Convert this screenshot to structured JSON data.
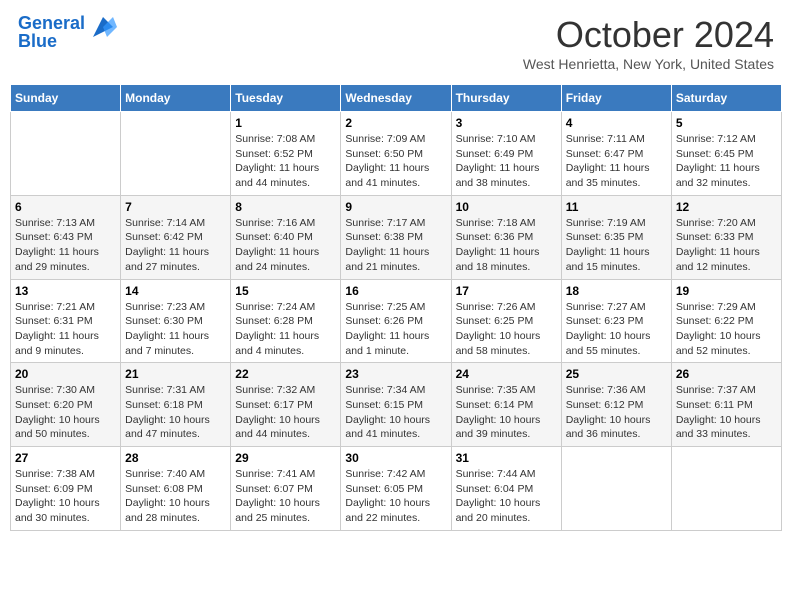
{
  "header": {
    "logo_line1": "General",
    "logo_line2": "Blue",
    "month_title": "October 2024",
    "location": "West Henrietta, New York, United States"
  },
  "days_of_week": [
    "Sunday",
    "Monday",
    "Tuesday",
    "Wednesday",
    "Thursday",
    "Friday",
    "Saturday"
  ],
  "weeks": [
    [
      {
        "day": "",
        "info": ""
      },
      {
        "day": "",
        "info": ""
      },
      {
        "day": "1",
        "info": "Sunrise: 7:08 AM\nSunset: 6:52 PM\nDaylight: 11 hours and 44 minutes."
      },
      {
        "day": "2",
        "info": "Sunrise: 7:09 AM\nSunset: 6:50 PM\nDaylight: 11 hours and 41 minutes."
      },
      {
        "day": "3",
        "info": "Sunrise: 7:10 AM\nSunset: 6:49 PM\nDaylight: 11 hours and 38 minutes."
      },
      {
        "day": "4",
        "info": "Sunrise: 7:11 AM\nSunset: 6:47 PM\nDaylight: 11 hours and 35 minutes."
      },
      {
        "day": "5",
        "info": "Sunrise: 7:12 AM\nSunset: 6:45 PM\nDaylight: 11 hours and 32 minutes."
      }
    ],
    [
      {
        "day": "6",
        "info": "Sunrise: 7:13 AM\nSunset: 6:43 PM\nDaylight: 11 hours and 29 minutes."
      },
      {
        "day": "7",
        "info": "Sunrise: 7:14 AM\nSunset: 6:42 PM\nDaylight: 11 hours and 27 minutes."
      },
      {
        "day": "8",
        "info": "Sunrise: 7:16 AM\nSunset: 6:40 PM\nDaylight: 11 hours and 24 minutes."
      },
      {
        "day": "9",
        "info": "Sunrise: 7:17 AM\nSunset: 6:38 PM\nDaylight: 11 hours and 21 minutes."
      },
      {
        "day": "10",
        "info": "Sunrise: 7:18 AM\nSunset: 6:36 PM\nDaylight: 11 hours and 18 minutes."
      },
      {
        "day": "11",
        "info": "Sunrise: 7:19 AM\nSunset: 6:35 PM\nDaylight: 11 hours and 15 minutes."
      },
      {
        "day": "12",
        "info": "Sunrise: 7:20 AM\nSunset: 6:33 PM\nDaylight: 11 hours and 12 minutes."
      }
    ],
    [
      {
        "day": "13",
        "info": "Sunrise: 7:21 AM\nSunset: 6:31 PM\nDaylight: 11 hours and 9 minutes."
      },
      {
        "day": "14",
        "info": "Sunrise: 7:23 AM\nSunset: 6:30 PM\nDaylight: 11 hours and 7 minutes."
      },
      {
        "day": "15",
        "info": "Sunrise: 7:24 AM\nSunset: 6:28 PM\nDaylight: 11 hours and 4 minutes."
      },
      {
        "day": "16",
        "info": "Sunrise: 7:25 AM\nSunset: 6:26 PM\nDaylight: 11 hours and 1 minute."
      },
      {
        "day": "17",
        "info": "Sunrise: 7:26 AM\nSunset: 6:25 PM\nDaylight: 10 hours and 58 minutes."
      },
      {
        "day": "18",
        "info": "Sunrise: 7:27 AM\nSunset: 6:23 PM\nDaylight: 10 hours and 55 minutes."
      },
      {
        "day": "19",
        "info": "Sunrise: 7:29 AM\nSunset: 6:22 PM\nDaylight: 10 hours and 52 minutes."
      }
    ],
    [
      {
        "day": "20",
        "info": "Sunrise: 7:30 AM\nSunset: 6:20 PM\nDaylight: 10 hours and 50 minutes."
      },
      {
        "day": "21",
        "info": "Sunrise: 7:31 AM\nSunset: 6:18 PM\nDaylight: 10 hours and 47 minutes."
      },
      {
        "day": "22",
        "info": "Sunrise: 7:32 AM\nSunset: 6:17 PM\nDaylight: 10 hours and 44 minutes."
      },
      {
        "day": "23",
        "info": "Sunrise: 7:34 AM\nSunset: 6:15 PM\nDaylight: 10 hours and 41 minutes."
      },
      {
        "day": "24",
        "info": "Sunrise: 7:35 AM\nSunset: 6:14 PM\nDaylight: 10 hours and 39 minutes."
      },
      {
        "day": "25",
        "info": "Sunrise: 7:36 AM\nSunset: 6:12 PM\nDaylight: 10 hours and 36 minutes."
      },
      {
        "day": "26",
        "info": "Sunrise: 7:37 AM\nSunset: 6:11 PM\nDaylight: 10 hours and 33 minutes."
      }
    ],
    [
      {
        "day": "27",
        "info": "Sunrise: 7:38 AM\nSunset: 6:09 PM\nDaylight: 10 hours and 30 minutes."
      },
      {
        "day": "28",
        "info": "Sunrise: 7:40 AM\nSunset: 6:08 PM\nDaylight: 10 hours and 28 minutes."
      },
      {
        "day": "29",
        "info": "Sunrise: 7:41 AM\nSunset: 6:07 PM\nDaylight: 10 hours and 25 minutes."
      },
      {
        "day": "30",
        "info": "Sunrise: 7:42 AM\nSunset: 6:05 PM\nDaylight: 10 hours and 22 minutes."
      },
      {
        "day": "31",
        "info": "Sunrise: 7:44 AM\nSunset: 6:04 PM\nDaylight: 10 hours and 20 minutes."
      },
      {
        "day": "",
        "info": ""
      },
      {
        "day": "",
        "info": ""
      }
    ]
  ]
}
